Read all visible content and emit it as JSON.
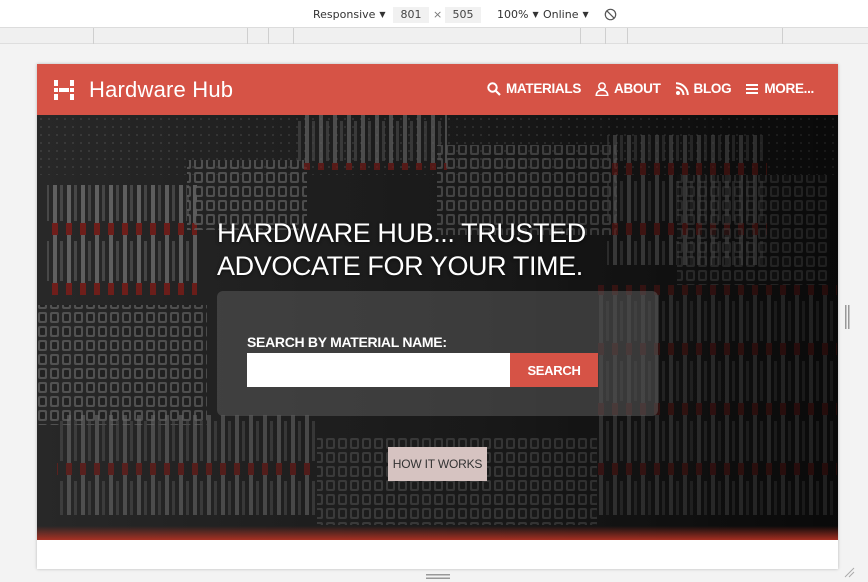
{
  "devtools": {
    "device": "Responsive",
    "width": "801",
    "times": "×",
    "height": "505",
    "zoom": "100%",
    "network": "Online",
    "rotate_icon": "rotate-icon"
  },
  "site": {
    "brand": "Hardware Hub",
    "logo_icon": "hardware-hub-logo-icon",
    "nav": [
      {
        "label": "MATERIALS",
        "icon": "search-icon"
      },
      {
        "label": "ABOUT",
        "icon": "user-icon"
      },
      {
        "label": "BLOG",
        "icon": "rss-icon"
      },
      {
        "label": "MORE...",
        "icon": "menu-icon"
      }
    ],
    "headline_line1": "HARDWARE  HUB... TRUSTED",
    "headline_line2": "ADVOCATE  FOR YOUR TIME.",
    "search_label": "SEARCH  BY  MATERIAL  NAME:",
    "search_value": "",
    "search_button": "SEARCH",
    "how_button": "HOW  IT WORKS"
  },
  "colors": {
    "brand_red": "#d65346",
    "panel": "rgba(90,90,90,0.55)",
    "secondary_button": "#d6c3c1"
  }
}
